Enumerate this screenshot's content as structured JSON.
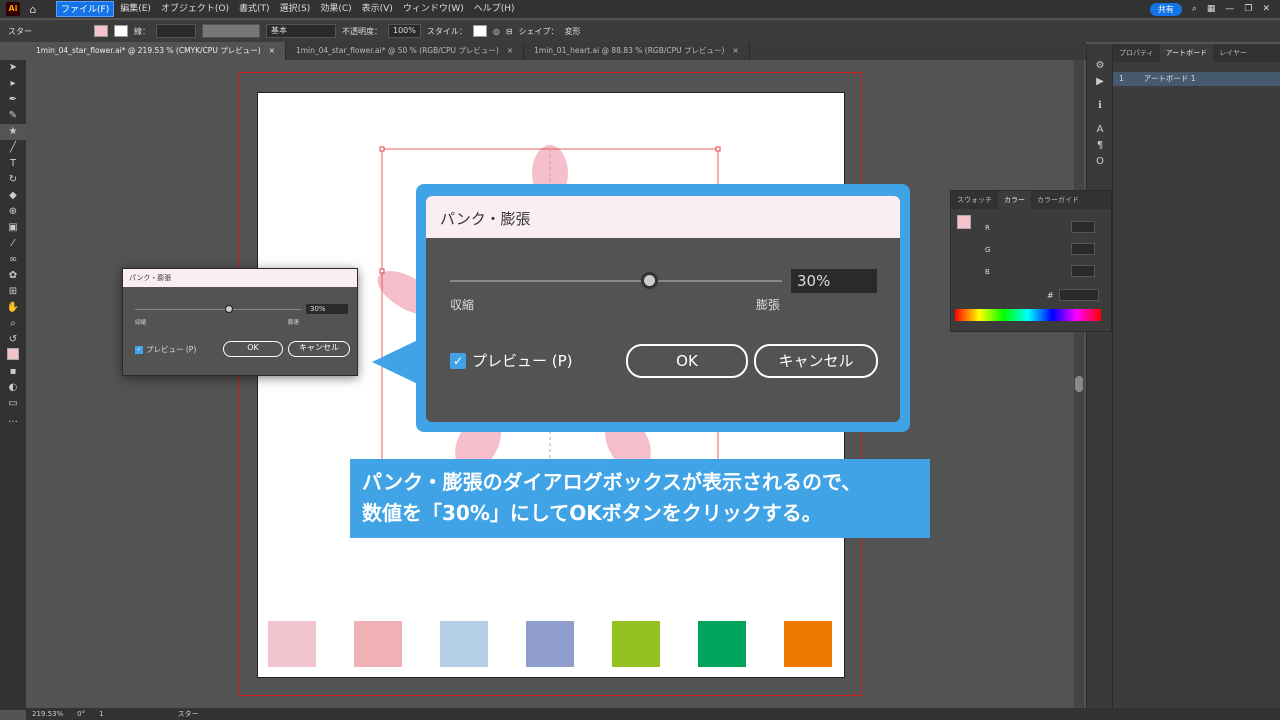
{
  "menubar": {
    "logo": "Ai",
    "items": [
      "ファイル(F)",
      "編集(E)",
      "オブジェクト(O)",
      "書式(T)",
      "選択(S)",
      "効果(C)",
      "表示(V)",
      "ウィンドウ(W)",
      "ヘルプ(H)"
    ],
    "share": "共有"
  },
  "control": {
    "object_type": "スター",
    "stroke_label": "線：",
    "stroke_profile": "基本",
    "opacity_label": "不透明度：",
    "opacity_value": "100%",
    "style_label": "スタイル：",
    "shape_label": "シェイプ：",
    "transform_label": "変形",
    "fill_color": "#f4c2cb"
  },
  "tabs": [
    {
      "label": "1min_04_star_flower.ai* @ 219.53 % (CMYK/CPU プレビュー)",
      "close": "×"
    },
    {
      "label": "1min_04_star_flower.ai* @ 50 % (RGB/CPU プレビュー)",
      "close": "×"
    },
    {
      "label": "1min_01_heart.ai @ 88.83 % (RGB/CPU プレビュー)",
      "close": "×"
    }
  ],
  "swatches": [
    "#f2c4cd",
    "#efb1b5",
    "#b6cfe9",
    "#8f9ecd",
    "#93c11f",
    "#00a45a",
    "#f07a00"
  ],
  "small_dialog": {
    "title": "パンク・膨張",
    "value": "30%",
    "left_label": "収縮",
    "right_label": "膨張",
    "preview_label": "プレビュー (P)",
    "ok": "OK",
    "cancel": "キャンセル"
  },
  "big_dialog": {
    "title": "パンク・膨張",
    "value": "30%",
    "left_label": "収縮",
    "right_label": "膨張",
    "preview_label": "プレビュー (P)",
    "ok": "OK",
    "cancel": "キャンセル",
    "slider_level": 0.6
  },
  "caption": {
    "line1": "パンク・膨張のダイアログボックスが表示されるので、",
    "line2": "数値を「30%」にしてOKボタンをクリックする。"
  },
  "right_panel": {
    "tabs": [
      "プロパティ",
      "アートボード",
      "レイヤー"
    ],
    "artboard_index": "1",
    "artboard_name": "アートボード 1"
  },
  "color_panel": {
    "tabs": [
      "スウォッチ",
      "カラー",
      "カラーガイド"
    ],
    "channels": [
      "R",
      "G",
      "B"
    ],
    "hex_label": "#"
  },
  "status": {
    "zoom": "219.53%",
    "angle": "0°",
    "artboard": "1",
    "tool": "スター"
  },
  "accent": "#3fa3e6"
}
